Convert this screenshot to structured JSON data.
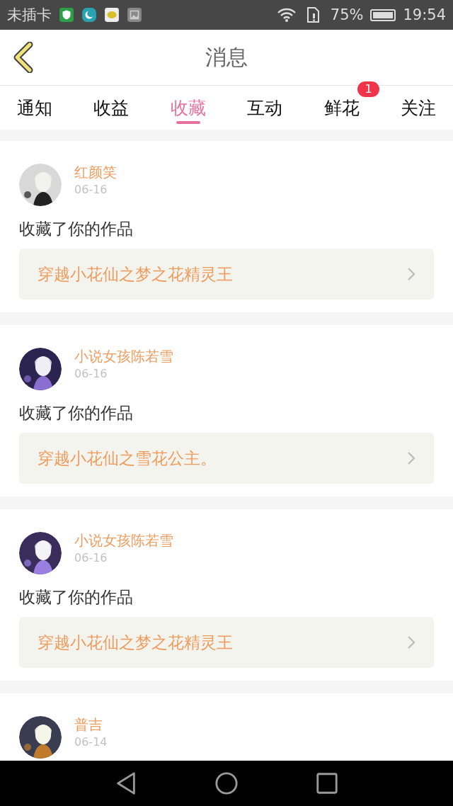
{
  "status_bar": {
    "carrier": "未插卡",
    "battery": "75%",
    "time": "19:54"
  },
  "header": {
    "title": "消息"
  },
  "tabs": [
    {
      "label": "通知",
      "selected": false
    },
    {
      "label": "收益",
      "selected": false
    },
    {
      "label": "收藏",
      "selected": true
    },
    {
      "label": "互动",
      "selected": false
    },
    {
      "label": "鲜花",
      "selected": false,
      "badge": "1"
    },
    {
      "label": "关注",
      "selected": false
    }
  ],
  "messages": [
    {
      "name": "红颜笑",
      "date": "06-16",
      "action": "收藏了你的作品",
      "work": "穿越小花仙之梦之花精灵王"
    },
    {
      "name": "小说女孩陈若雪",
      "date": "06-16",
      "action": "收藏了你的作品",
      "work": "穿越小花仙之雪花公主。"
    },
    {
      "name": "小说女孩陈若雪",
      "date": "06-16",
      "action": "收藏了你的作品",
      "work": "穿越小花仙之梦之花精灵王"
    },
    {
      "name": "普吉",
      "date": "06-14"
    }
  ]
}
